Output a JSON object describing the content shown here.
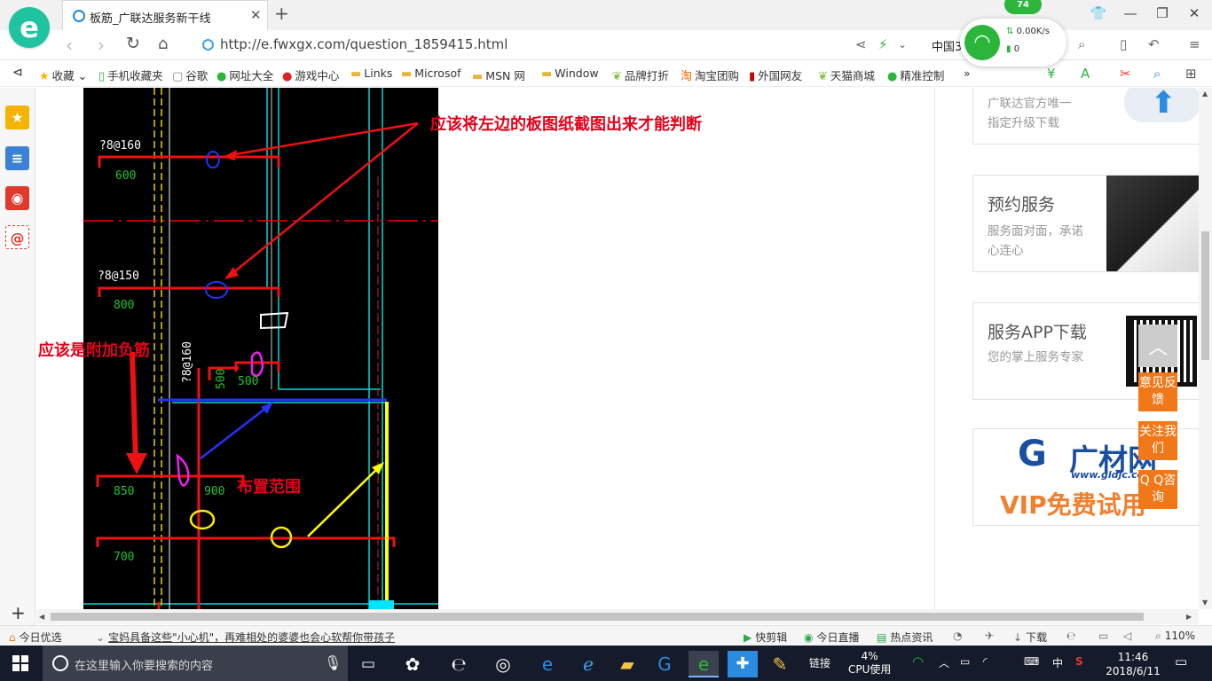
{
  "browser": {
    "tab_title": "板筋_广联达服务新干线",
    "url": "http://e.fwxgx.com/question_1859415.html",
    "addr_right_text": "中国3",
    "new_tab": "+",
    "close": "✕"
  },
  "network": {
    "badge": "74",
    "speed": "0.00K/s",
    "count": "0"
  },
  "bookmarks": [
    {
      "label": "收藏",
      "icon": "star-icon"
    },
    {
      "label": "手机收藏夹",
      "icon": "phone-icon"
    },
    {
      "label": "谷歌",
      "icon": "page-icon"
    },
    {
      "label": "网址大全",
      "icon": "compass-icon"
    },
    {
      "label": "游戏中心",
      "icon": "game-icon"
    },
    {
      "label": "Links",
      "icon": "folder-icon"
    },
    {
      "label": "Microsof",
      "icon": "folder-icon"
    },
    {
      "label": "MSN 网",
      "icon": "folder-icon"
    },
    {
      "label": "Window",
      "icon": "folder-icon"
    },
    {
      "label": "品牌打折",
      "icon": "leaf-icon"
    },
    {
      "label": "淘宝团购",
      "icon": "taobao-icon"
    },
    {
      "label": "外国网友",
      "icon": "flag-icon"
    },
    {
      "label": "天猫商城",
      "icon": "leaf-icon"
    },
    {
      "label": "精准控制",
      "icon": "chat-icon"
    }
  ],
  "bookmarks_more": "»",
  "drawing": {
    "labels": [
      "?8@160",
      "600",
      "?8@150",
      "800",
      "?8@160",
      "500",
      "850",
      "900",
      "700"
    ]
  },
  "annotations": {
    "top": "应该将左边的板图纸截图出来才能判断",
    "left": "应该是附加负筋",
    "range": "布置范围"
  },
  "cards": {
    "upgrade": {
      "text_line1": "广联达官方唯一",
      "text_line2": "指定升级下载"
    },
    "booking": {
      "title": "预约服务",
      "subtitle": "服务面对面，承诺心连心"
    },
    "app": {
      "title": "服务APP下载",
      "subtitle": "您的掌上服务专家"
    },
    "vip": {
      "brand": "广材网",
      "site": "www.gldjc.com",
      "slogan": "VIP免费试用"
    }
  },
  "float_buttons": {
    "feedback": "意见反馈",
    "follow": "关注我们",
    "qq": "Q Q咨询"
  },
  "status_bar": {
    "today": "今日优选",
    "news": "宝妈具备这些\"小心机\"，再难相处的婆婆也会心软帮你带孩子",
    "quick_clip": "快剪辑",
    "live": "今日直播",
    "hot_news": "热点资讯",
    "download": "下载",
    "zoom": "110%"
  },
  "taskbar": {
    "search_placeholder": "在这里输入你要搜索的内容",
    "link": "链接",
    "cpu_percent": "4%",
    "cpu_label": "CPU使用",
    "ime": "中",
    "time": "11:46",
    "date": "2018/6/11"
  },
  "colors": {
    "accent_green": "#2bb53a",
    "annotation_red": "#e5001a",
    "float_orange": "#f07818",
    "taskbar": "#161b2b"
  }
}
